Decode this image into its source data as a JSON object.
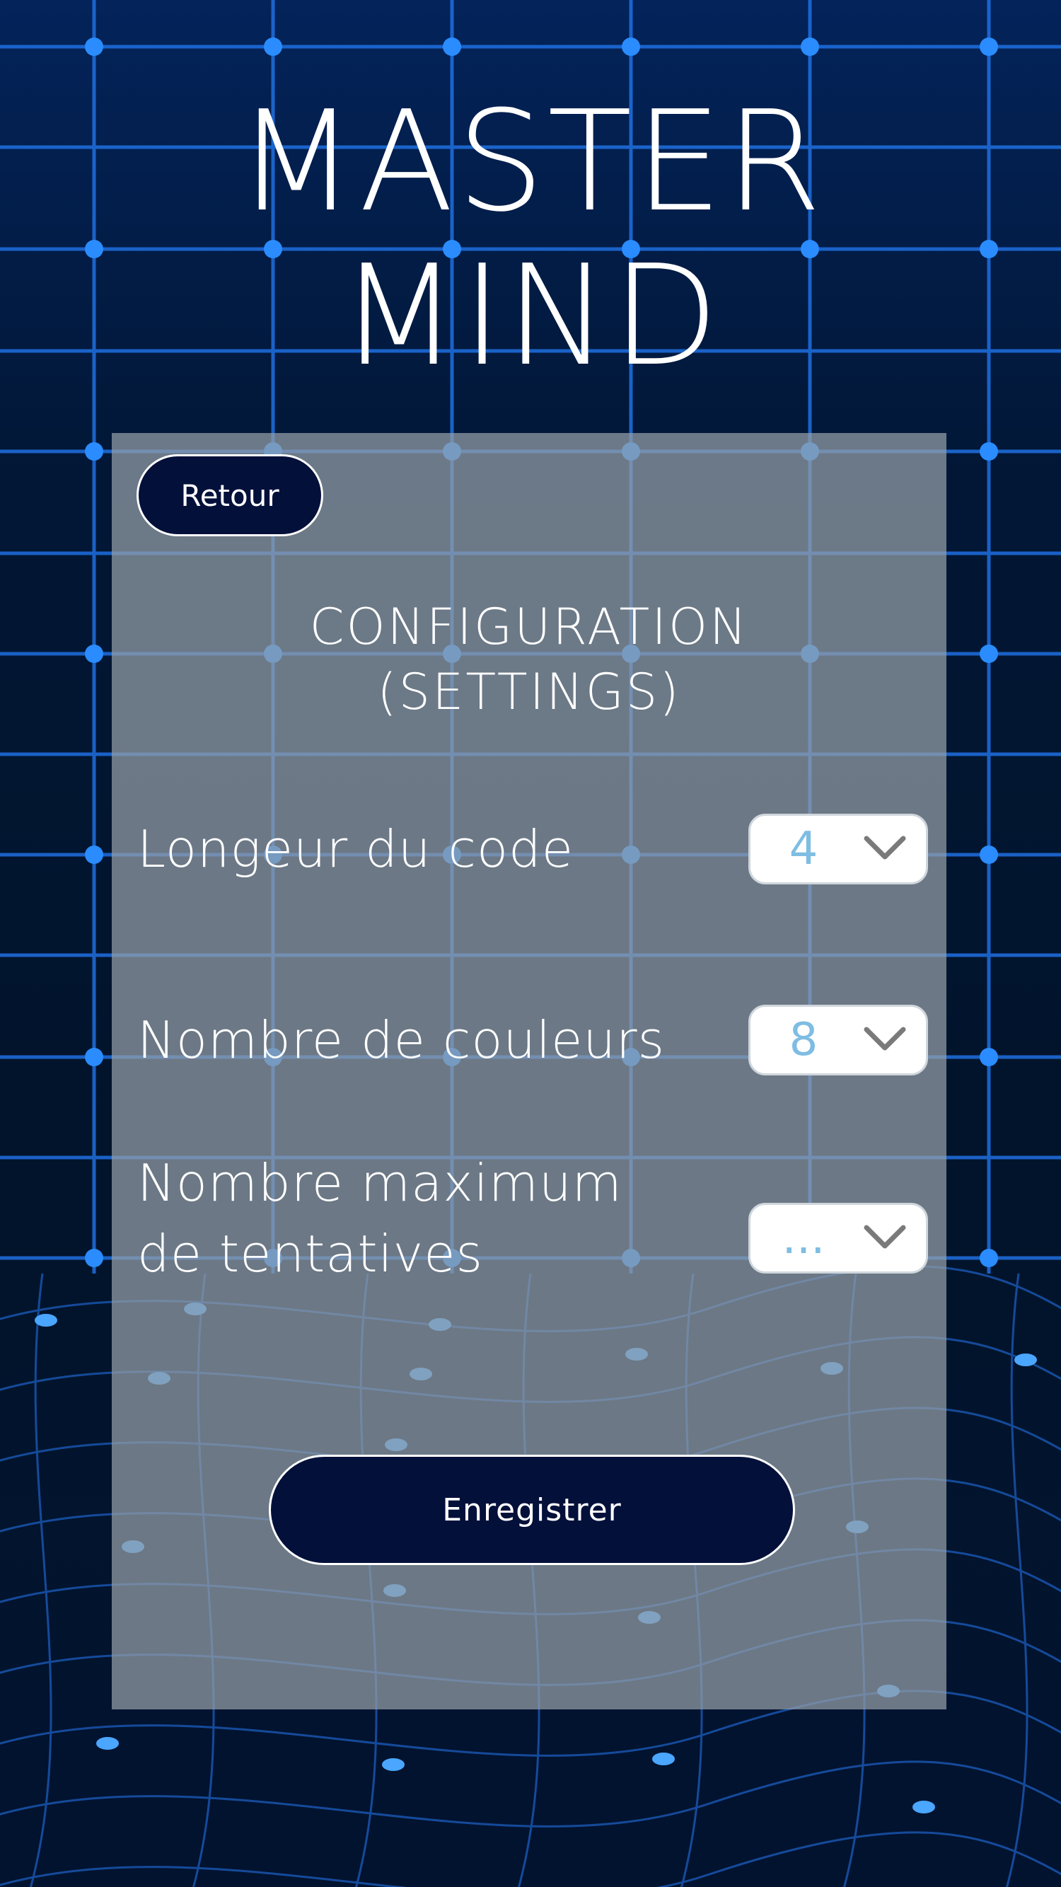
{
  "app": {
    "title_line1": "MASTER",
    "title_line2": "MIND"
  },
  "nav": {
    "back_label": "Retour"
  },
  "settings": {
    "heading_line1": "CONFIGURATION",
    "heading_line2": "(SETTINGS)",
    "code_length": {
      "label": "Longeur du code",
      "value": "4"
    },
    "color_count": {
      "label": "Nombre de couleurs",
      "value": "8"
    },
    "max_attempts": {
      "label_line1": "Nombre maximum",
      "label_line2": "de tentatives",
      "value": "..."
    },
    "save_label": "Enregistrer"
  },
  "icons": {
    "dropdown": "chevron-down-icon"
  },
  "colors": {
    "background": "#02152e",
    "grid_line": "#1f6fe0",
    "grid_dot": "#2a8cff",
    "panel": "#8e989f",
    "button": "#03103a",
    "select_value": "#7fbde3",
    "text": "#ffffff"
  }
}
